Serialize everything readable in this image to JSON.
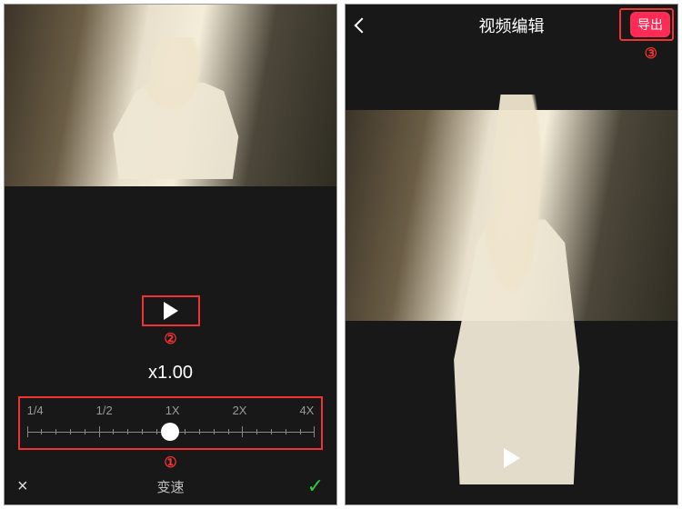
{
  "left": {
    "speed_value": "x1.00",
    "tick_labels": [
      "1/4",
      "1/2",
      "1X",
      "2X",
      "4X"
    ],
    "knob_position_pct": 50,
    "footer": {
      "close_label": "×",
      "title": "变速",
      "confirm_label": "✓"
    },
    "annotations": {
      "play": "②",
      "slider": "①"
    }
  },
  "right": {
    "title": "视频编辑",
    "export_label": "导出",
    "annotations": {
      "export": "③"
    }
  }
}
